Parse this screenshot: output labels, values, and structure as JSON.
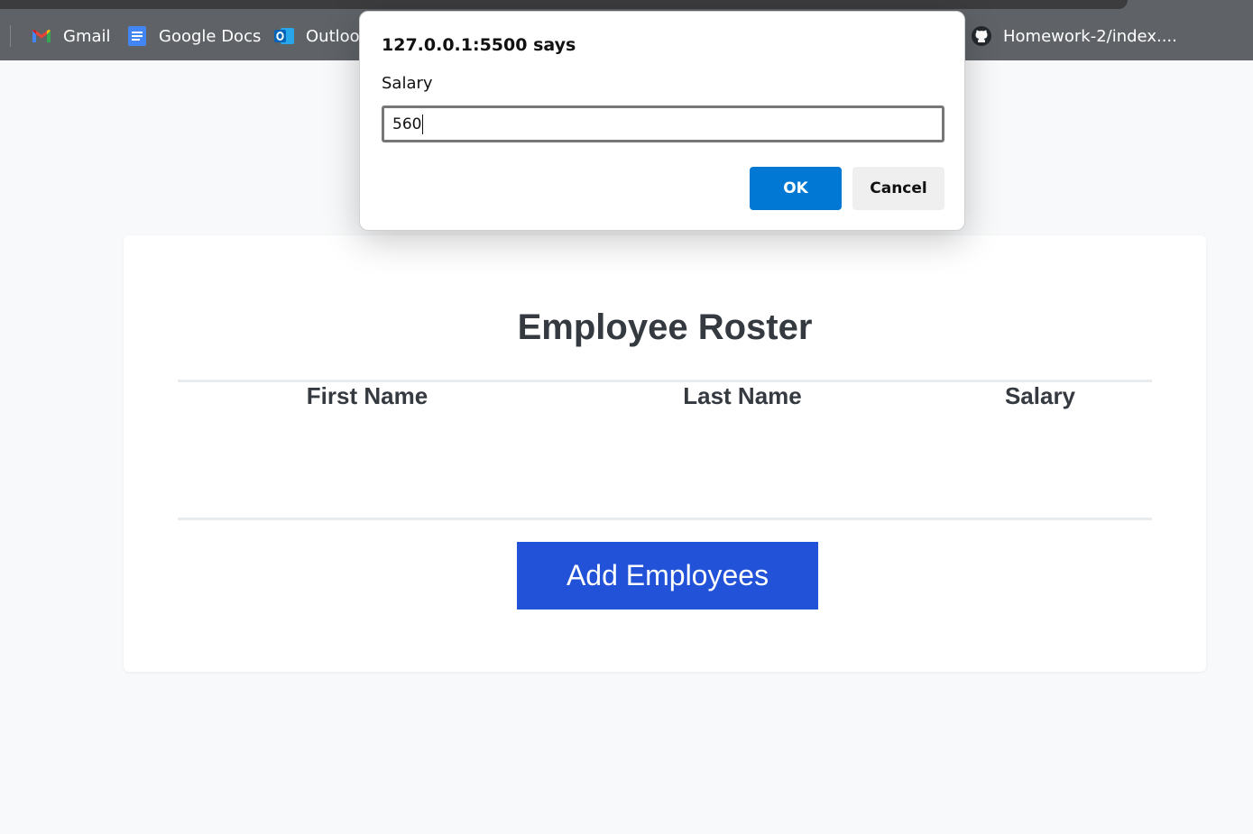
{
  "bookmarks": {
    "items": [
      {
        "label": "Gmail",
        "icon": "gmail-icon"
      },
      {
        "label": "Google Docs",
        "icon": "google-docs-icon"
      },
      {
        "label": "Outlook",
        "icon": "outlook-icon"
      },
      {
        "label": "Homework-2/index....",
        "icon": "github-icon"
      }
    ]
  },
  "dialog": {
    "title": "127.0.0.1:5500 says",
    "message": "Salary",
    "input_value": "560",
    "ok_label": "OK",
    "cancel_label": "Cancel"
  },
  "roster": {
    "title": "Employee Roster",
    "columns": [
      "First Name",
      "Last Name",
      "Salary"
    ],
    "add_button_label": "Add Employees"
  },
  "colors": {
    "accent_button": "#2252d7",
    "dialog_ok": "#0078d4",
    "heading_text": "#343a40",
    "bookmarks_bar": "#5f6368"
  }
}
